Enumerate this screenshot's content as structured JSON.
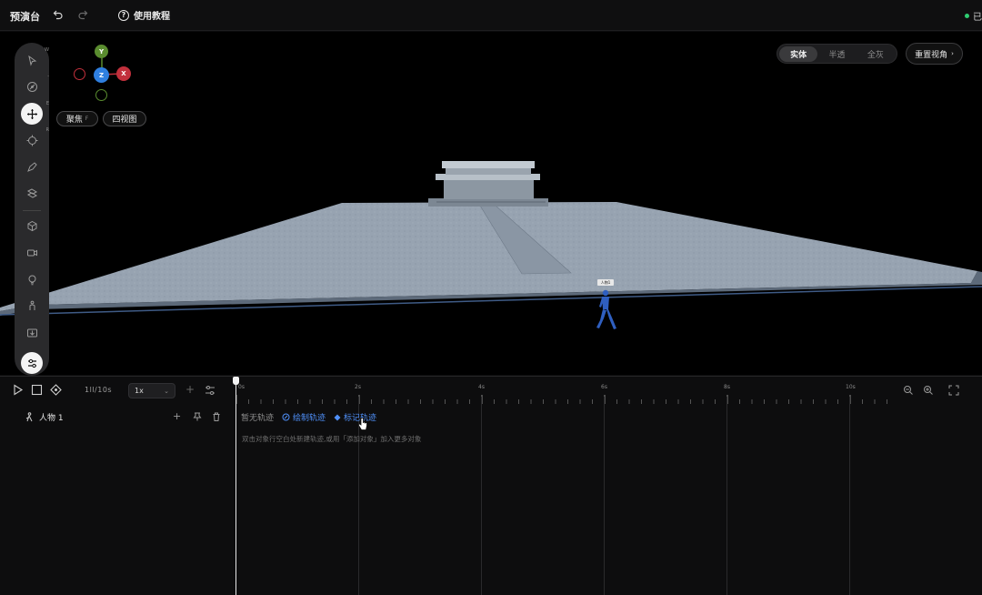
{
  "topbar": {
    "title": "预演台",
    "undo_icon": "undo-icon",
    "redo_icon": "redo-icon",
    "tutorial_label": "使用教程",
    "tutorial_icon": "question-circle-icon",
    "save_status": "已",
    "status_color": "#2ecc71"
  },
  "toolbar": {
    "tools": [
      {
        "name": "select-tool",
        "icon": "cursor-arrow-icon",
        "key": "W"
      },
      {
        "name": "orbit-tool",
        "icon": "orbit-icon",
        "key": "-"
      },
      {
        "name": "move-tool",
        "icon": "move-arrows-icon",
        "key": "E",
        "active": true
      },
      {
        "name": "rotate-tool",
        "icon": "rotate-icon",
        "key": "R"
      },
      {
        "name": "pen-tool",
        "icon": "pen-icon",
        "key": ""
      },
      {
        "name": "transform-tool",
        "icon": "transform-icon",
        "key": ""
      },
      {
        "name": "cube-tool",
        "icon": "cube-icon",
        "key": ""
      },
      {
        "name": "camera-tool",
        "icon": "camera-icon",
        "key": ""
      },
      {
        "name": "light-tool",
        "icon": "light-bulb-icon",
        "key": ""
      },
      {
        "name": "figure-tool",
        "icon": "figure-icon",
        "key": ""
      },
      {
        "name": "import-tool",
        "icon": "import-icon",
        "key": ""
      },
      {
        "name": "config-tool",
        "icon": "config-icon",
        "key": ""
      }
    ]
  },
  "gizmo": {
    "y_label": "Y",
    "z_label": "Z",
    "x_label": "X",
    "focus_label": "聚焦",
    "focus_key": "F",
    "four_view_label": "四视图",
    "colors": {
      "y": "#5a8c2f",
      "z": "#2f7fe0",
      "x": "#c2303c"
    }
  },
  "view_modes": {
    "options": [
      "实体",
      "半透",
      "全灰"
    ],
    "selected": "实体",
    "reset_label": "重置视角"
  },
  "scene": {
    "character_tag": "人物1"
  },
  "timeline": {
    "time_readout": "1ll/10s",
    "speed": "1x",
    "add_symbol": "+",
    "ruler_labels": [
      "0s",
      "2s",
      "4s",
      "6s",
      "8s",
      "10s"
    ],
    "track_name": "人物 1",
    "no_track_text": "暂无轨迹",
    "draw_track_label": "绘制轨迹",
    "mark_track_label": "标记轨迹",
    "hint_text": "双击对象行空白处新建轨迹,或用「添加对象」加入更多对象",
    "link_color": "#4f8ff7"
  }
}
